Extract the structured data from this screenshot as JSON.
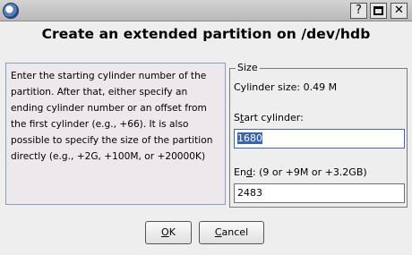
{
  "window": {
    "title_buttons": {
      "help": "?",
      "close": "✕"
    }
  },
  "heading": "Create an extended partition on /dev/hdb",
  "description": "Enter the starting cylinder number of the partition. After that, either specify an ending cylinder number or an offset from the first cylinder (e.g., +66). It is also possible to specify the size of the partition directly (e.g., +2G, +100M, or +20000K)",
  "size_group": {
    "title": "Size",
    "cylinder_size_label": "Cylinder size: 0.49 M",
    "start_label_pre": "S",
    "start_label_u": "t",
    "start_label_post": "art cylinder:",
    "start_value": "1680",
    "end_label_pre": "En",
    "end_label_u": "d",
    "end_label_post": ":  (9 or +9M or +3.2GB)",
    "end_value": "2483"
  },
  "buttons": {
    "ok_u": "O",
    "ok_post": "K",
    "cancel_u": "C",
    "cancel_post": "ancel"
  }
}
